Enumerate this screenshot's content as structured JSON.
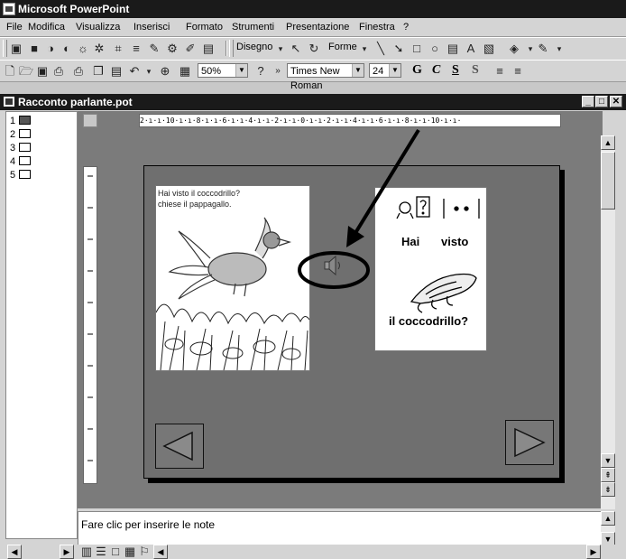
{
  "app": {
    "title": "Microsoft PowerPoint"
  },
  "menu": [
    "File",
    "Modifica",
    "Visualizza",
    "Inserisci",
    "Formato",
    "Strumenti",
    "Presentazione",
    "Finestra",
    "?"
  ],
  "drawing_toolbar": {
    "disegno_label": "Disegno",
    "forme_label": "Forme"
  },
  "standard_toolbar": {
    "zoom": "50%",
    "font_name": "Times New Roman",
    "font_size": "24",
    "bold": "G",
    "italic": "C",
    "underline": "S",
    "shadow": "S"
  },
  "document": {
    "title": "Racconto parlante.pot"
  },
  "outline": {
    "slides": [
      "1",
      "2",
      "3",
      "4",
      "5"
    ],
    "selected": "1"
  },
  "ruler": {
    "horizontal": "2·ı·ı·10·ı·ı·8·ı·ı·6·ı·ı·4·ı·ı·2·ı·ı·0·ı·ı·2·ı·ı·4·ı·ı·6·ı·ı·8·ı·ı·10·ı·ı·"
  },
  "slide": {
    "picture_caption_line1": "Hai visto il coccodrillo?",
    "picture_caption_line2": "chiese il pappagallo.",
    "symbols_word1": "Hai",
    "symbols_word2": "visto",
    "symbols_word3": "il coccodrillo?"
  },
  "notes": {
    "placeholder": "Fare clic per inserire le note"
  }
}
